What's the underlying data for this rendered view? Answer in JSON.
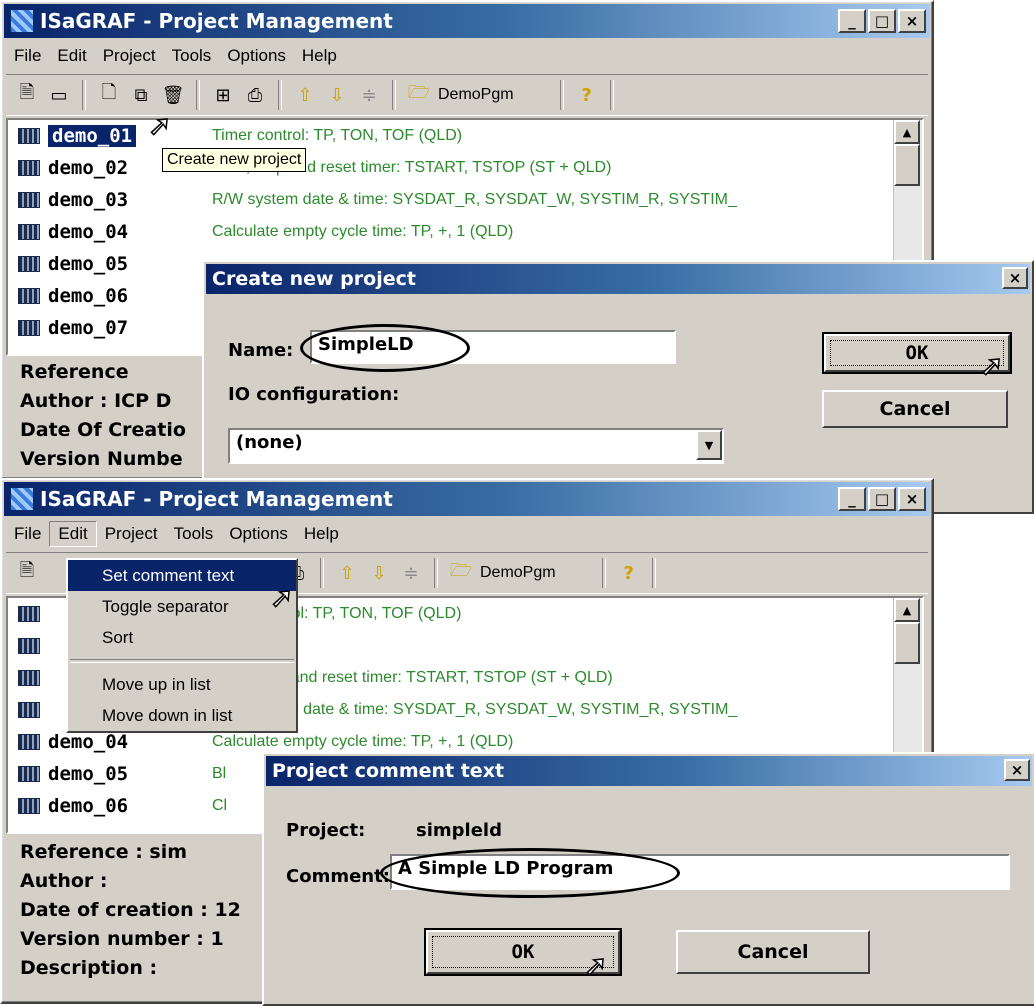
{
  "window1": {
    "title": "ISaGRAF - Project Management",
    "menu": [
      "File",
      "Edit",
      "Project",
      "Tools",
      "Options",
      "Help"
    ],
    "toolbar_program": "DemoPgm",
    "tooltip": "Create new project",
    "projects": [
      {
        "name": "demo_01",
        "comment": "Timer control:  TP, TON, TOF  (QLD)"
      },
      {
        "name": "demo_02",
        "comment": "Start, stop and reset timer:  TSTART, TSTOP  (ST + QLD)"
      },
      {
        "name": "demo_03",
        "comment": "R/W system date & time:  SYSDAT_R, SYSDAT_W, SYSTIM_R, SYSTIM_"
      },
      {
        "name": "demo_04",
        "comment": "Calculate empty cycle time:  TP, +, 1  (QLD)"
      },
      {
        "name": "demo_05",
        "comment": ""
      },
      {
        "name": "demo_06",
        "comment": ""
      },
      {
        "name": "demo_07",
        "comment": ""
      }
    ],
    "info": [
      "Reference",
      "Author    : ICP D",
      "Date Of Creatio",
      "Version Numbe"
    ]
  },
  "dialog1": {
    "title": "Create new project",
    "name_label": "Name:",
    "name_value": "SimpleLD",
    "io_label": "IO configuration:",
    "io_value": "(none)",
    "ok": "OK",
    "cancel": "Cancel"
  },
  "window2": {
    "title": "ISaGRAF - Project Management",
    "menu": [
      "File",
      "Edit",
      "Project",
      "Tools",
      "Options",
      "Help"
    ],
    "toolbar_program": "DemoPgm",
    "edit_menu": [
      "Set comment text",
      "Toggle separator",
      "Sort",
      "Move up in list",
      "Move down in list"
    ],
    "rows": [
      {
        "name": "",
        "comment": "control:  TP, TON, TOF  (QLD)"
      },
      {
        "name": "",
        "comment": ""
      },
      {
        "name": "",
        "comment": "stop and reset timer:  TSTART, TSTOP  (ST + QLD)"
      },
      {
        "name": "",
        "comment": "ystem date & time:  SYSDAT_R, SYSDAT_W, SYSTIM_R, SYSTIM_"
      },
      {
        "name": "demo_04",
        "comment": "Calculate empty cycle time:  TP, +, 1  (QLD)"
      },
      {
        "name": "demo_05",
        "comment": "Bl"
      },
      {
        "name": "demo_06",
        "comment": "Cl"
      }
    ],
    "info": [
      "Reference      : sim",
      "Author          :",
      "Date of creation : 12",
      "Version number  : 1",
      "Description     :"
    ]
  },
  "dialog2": {
    "title": "Project comment text",
    "project_label": "Project:",
    "project_value": "simpleld",
    "comment_label": "Comment:",
    "comment_value": "A Simple LD Program",
    "ok": "OK",
    "cancel": "Cancel"
  }
}
